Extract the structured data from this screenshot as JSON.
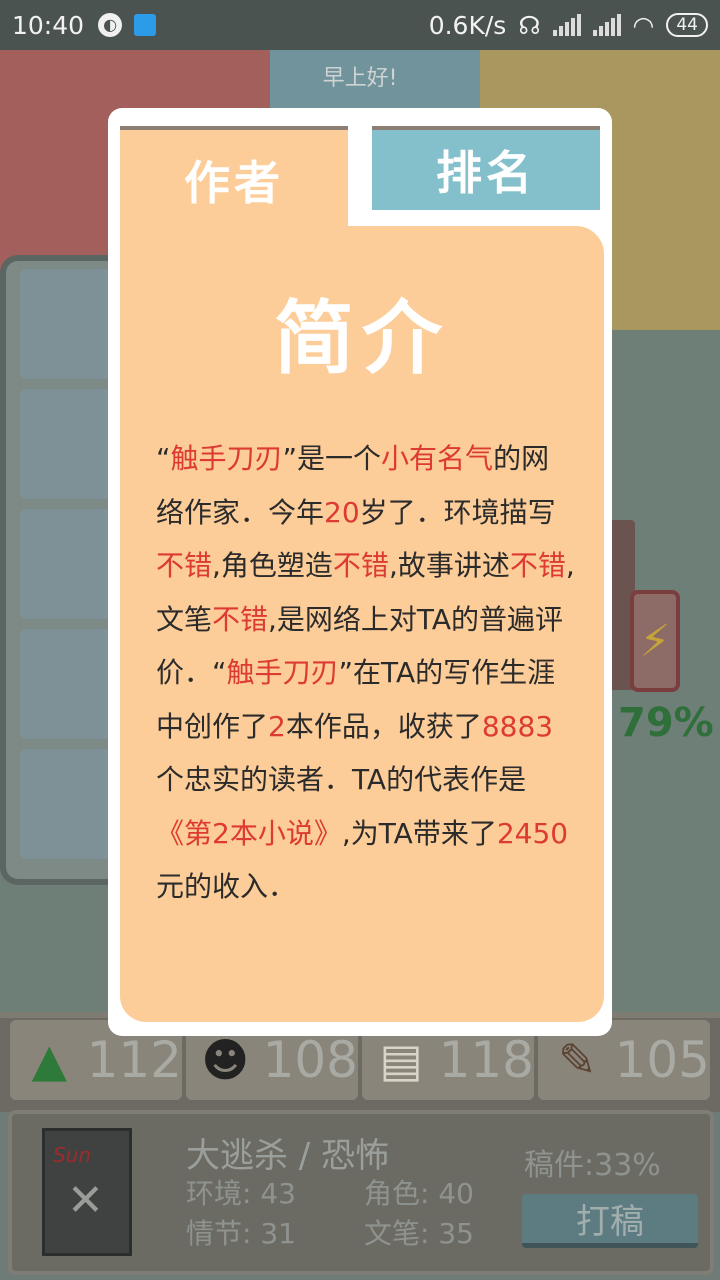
{
  "status_bar": {
    "time": "10:40",
    "network_speed": "0.6K/s",
    "battery": "44"
  },
  "greeting": "早上好!",
  "background": {
    "energy_percent": "79%"
  },
  "modal": {
    "tabs": [
      {
        "label": "作者",
        "active": true
      },
      {
        "label": "排名",
        "active": false
      }
    ],
    "title": "简介",
    "description": {
      "quote_open": "“",
      "author_name": "触手刀刃",
      "quote_close_1": "”是一个",
      "fame": "小有名气",
      "t1": "的网络作家．今年",
      "age": "20",
      "t2": "岁了．环境描写",
      "env_rating": "不错",
      "t3": ",角色塑造",
      "role_rating": "不错",
      "t4": ",故事讲述",
      "story_rating": "不错",
      "t5": ",文笔",
      "style_rating": "不错",
      "t6": ",是网络上对TA的普遍评价．“",
      "author_name_2": "触手刀刃",
      "t7": "”在TA的写作生涯中创作了",
      "work_count": "2",
      "t8": "本作品，收获了",
      "readers": "8883",
      "t9": "个忠实的读者．TA的代表作是",
      "masterpiece": "《第2本小说》",
      "t10": ",为TA带来了",
      "income": "2450",
      "t11": "元的收入．"
    }
  },
  "stats": [
    {
      "icon": "tree-icon",
      "value": "112"
    },
    {
      "icon": "character-icon",
      "value": "108"
    },
    {
      "icon": "book-icon",
      "value": "118"
    },
    {
      "icon": "pencil-icon",
      "value": "105"
    }
  ],
  "novel": {
    "cover_text": "Sun",
    "title": "大逃杀 / 恐怖",
    "environment": "环境: 43",
    "role": "角色: 40",
    "plot": "情节: 31",
    "style": "文笔: 35",
    "draft": "稿件:33%",
    "write_button": "打稿"
  }
}
